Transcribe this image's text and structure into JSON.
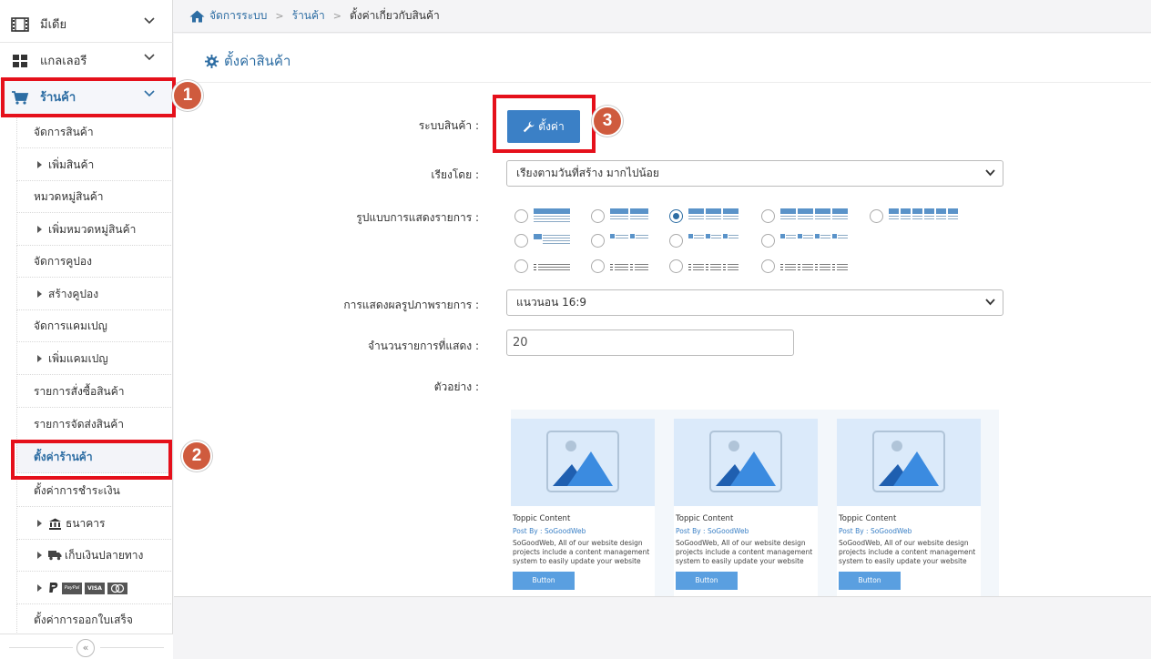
{
  "sidebar": {
    "top_items": [
      {
        "label": "มีเดีย",
        "icon": "film-icon"
      },
      {
        "label": "แกลเลอรี",
        "icon": "grid-icon"
      },
      {
        "label": "ร้านค้า",
        "icon": "cart-icon"
      }
    ],
    "items": [
      {
        "label": "จัดการสินค้า"
      },
      {
        "label": "เพิ่มสินค้า"
      },
      {
        "label": "หมวดหมู่สินค้า"
      },
      {
        "label": "เพิ่มหมวดหมู่สินค้า"
      },
      {
        "label": "จัดการคูปอง"
      },
      {
        "label": "สร้างคูปอง"
      },
      {
        "label": "จัดการแคมเปญ"
      },
      {
        "label": "เพิ่มแคมเปญ"
      },
      {
        "label": "รายการสั่งซื้อสินค้า"
      },
      {
        "label": "รายการจัดส่งสินค้า"
      },
      {
        "label": "ตั้งค่าร้านค้า"
      },
      {
        "label": "ตั้งค่าการชำระเงิน"
      },
      {
        "label": "ธนาคาร"
      },
      {
        "label": "เก็บเงินปลายทาง"
      },
      {
        "label": ""
      },
      {
        "label": "ตั้งค่าการออกใบเสร็จ"
      }
    ],
    "payment_logos": [
      "PayPal",
      "VISA"
    ]
  },
  "breadcrumb": {
    "home": "จัดการระบบ",
    "shop": "ร้านค้า",
    "current": "ตั้งค่าเกี่ยวกับสินค้า"
  },
  "page": {
    "title": "ตั้งค่าสินค้า",
    "system_label": "ระบบสินค้า :",
    "settings_button": "ตั้งค่า",
    "sort_label": "เรียงโดย :",
    "sort_value": "เรียงตามวันที่สร้าง มากไปน้อย",
    "layout_label": "รูปแบบการแสดงรายการ :",
    "image_label": "การแสดงผลรูปภาพรายการ :",
    "image_value": "แนวนอน 16:9",
    "count_label": "จำนวนรายการที่แสดง :",
    "count_value": "20",
    "preview_label": "ตัวอย่าง :"
  },
  "preview_cards": [
    {
      "title": "Toppic Content",
      "by": "Post By : SoGoodWeb",
      "desc": "SoGoodWeb, All of our website design projects include a content management system to easily update your website on",
      "button": "Button"
    },
    {
      "title": "Toppic Content",
      "by": "Post By : SoGoodWeb",
      "desc": "SoGoodWeb, All of our website design projects include a content management system to easily update your website on",
      "button": "Button"
    },
    {
      "title": "Toppic Content",
      "by": "Post By : SoGoodWeb",
      "desc": "SoGoodWeb, All of our website design projects include a content management system to easily update your website on",
      "button": "Button"
    }
  ],
  "annotations": [
    "1",
    "2",
    "3"
  ],
  "colors": {
    "accent": "#2d6da3",
    "button": "#3b80c6",
    "highlight": "#e5101b",
    "badge": "#cf5b3e"
  }
}
